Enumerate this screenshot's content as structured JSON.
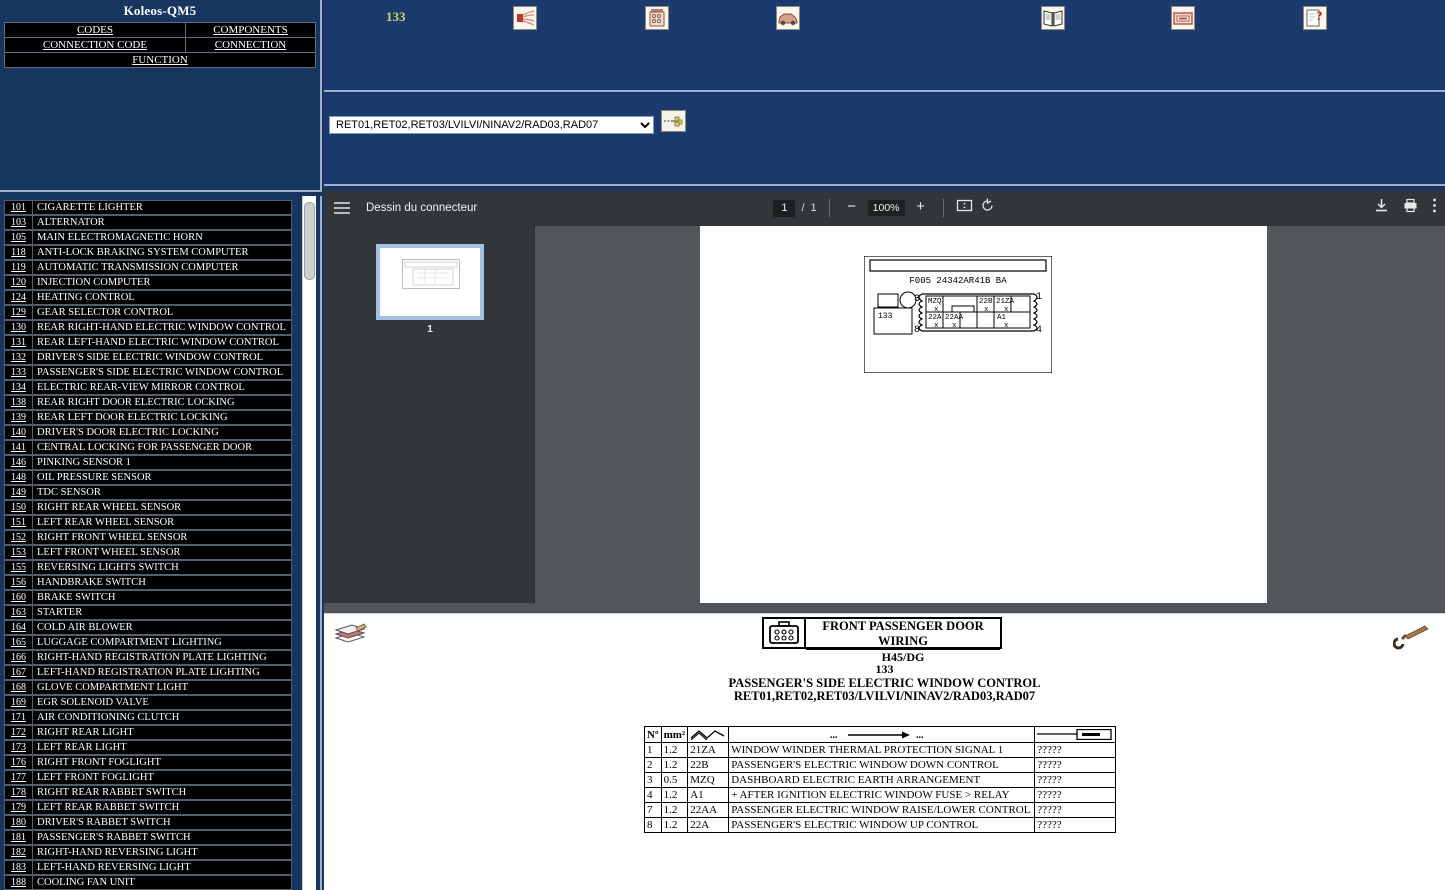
{
  "nav": {
    "title": "Koleos-QM5",
    "rows": [
      [
        {
          "label": "CODES",
          "name": "nav-link-codes"
        },
        {
          "label": "COMPONENTS",
          "name": "nav-link-components"
        }
      ],
      [
        {
          "label": "CONNECTION CODE",
          "name": "nav-link-connection-code"
        },
        {
          "label": "CONNECTION",
          "name": "nav-link-connection"
        }
      ]
    ],
    "function_label": "FUNCTION"
  },
  "banner": {
    "code": "133",
    "icons": [
      {
        "name": "wiring-harness-icon",
        "label": "wiring-harness"
      },
      {
        "name": "connector-list-icon",
        "label": "connector-list"
      },
      {
        "name": "vehicle-icon",
        "label": "vehicle"
      },
      {
        "name": "manual-book-icon",
        "label": "manual-book"
      },
      {
        "name": "fuse-box-icon",
        "label": "fuse-box"
      },
      {
        "name": "help-document-icon",
        "label": "help-document"
      }
    ]
  },
  "selector": {
    "value": "RET01,RET02,RET03/LVILVI/NINAV2/RAD03,RAD07",
    "options": [
      "RET01,RET02,RET03/LVILVI/NINAV2/RAD03,RAD07"
    ],
    "go_button_name": "go-button"
  },
  "pdf": {
    "doc_title": "Dessin du connecteur",
    "page_current": "1",
    "page_sep": "/",
    "page_total": "1",
    "zoom": "100%",
    "minus": "−",
    "plus": "+",
    "thumbnail_label": "1"
  },
  "connector_drawing": {
    "header_ref": "F005  24342AR41B BA",
    "component_code": "133",
    "corner_top_left": "3",
    "corner_top_right": "1",
    "corner_bottom_left": "8",
    "corner_bottom_right": "4",
    "cells_top": [
      "MZQ",
      "22B",
      "21ZA"
    ],
    "cells_bottom": [
      "22A",
      "22AA",
      "A1"
    ]
  },
  "info": {
    "connector_title": "FRONT PASSENGER DOOR WIRING",
    "connector_ref": "H45/DG",
    "component_code": "133",
    "component_name": "PASSENGER'S SIDE ELECTRIC WINDOW CONTROL",
    "variants": "RET01,RET02,RET03/LVILVI/NINAV2/RAD03,RAD07",
    "books_icon_name": "books-icon",
    "wrench_icon_name": "wrench-icon"
  },
  "wire_table": {
    "headers": [
      "Nº",
      "mm²",
      "",
      "",
      ""
    ],
    "rows": [
      {
        "no": "1",
        "mm2": "1.2",
        "code": "21ZA",
        "desc": "WINDOW WINDER THERMAL PROTECTION SIGNAL 1",
        "link": "?????"
      },
      {
        "no": "2",
        "mm2": "1.2",
        "code": "22B",
        "desc": "PASSENGER'S ELECTRIC WINDOW DOWN CONTROL",
        "link": "?????"
      },
      {
        "no": "3",
        "mm2": "0.5",
        "code": "MZQ",
        "desc": "DASHBOARD ELECTRIC EARTH ARRANGEMENT",
        "link": "?????"
      },
      {
        "no": "4",
        "mm2": "1.2",
        "code": "A1",
        "desc": "+ AFTER IGNITION ELECTRIC WINDOW FUSE > RELAY",
        "link": "?????"
      },
      {
        "no": "7",
        "mm2": "1.2",
        "code": "22AA",
        "desc": "PASSENGER ELECTRIC WINDOW RAISE/LOWER CONTROL",
        "link": "?????"
      },
      {
        "no": "8",
        "mm2": "1.2",
        "code": "22A",
        "desc": "PASSENGER'S ELECTRIC WINDOW UP CONTROL",
        "link": "?????"
      }
    ]
  },
  "components_list": [
    {
      "code": "101",
      "label": "CIGARETTE LIGHTER"
    },
    {
      "code": "103",
      "label": "ALTERNATOR"
    },
    {
      "code": "105",
      "label": "MAIN ELECTROMAGNETIC HORN"
    },
    {
      "code": "118",
      "label": "ANTI-LOCK BRAKING SYSTEM COMPUTER"
    },
    {
      "code": "119",
      "label": "AUTOMATIC TRANSMISSION COMPUTER"
    },
    {
      "code": "120",
      "label": "INJECTION COMPUTER"
    },
    {
      "code": "124",
      "label": "HEATING CONTROL"
    },
    {
      "code": "129",
      "label": "GEAR SELECTOR CONTROL"
    },
    {
      "code": "130",
      "label": "REAR RIGHT-HAND ELECTRIC WINDOW CONTROL"
    },
    {
      "code": "131",
      "label": "REAR LEFT-HAND ELECTRIC WINDOW CONTROL"
    },
    {
      "code": "132",
      "label": "DRIVER'S SIDE ELECTRIC WINDOW CONTROL"
    },
    {
      "code": "133",
      "label": "PASSENGER'S SIDE ELECTRIC WINDOW CONTROL"
    },
    {
      "code": "134",
      "label": "ELECTRIC REAR-VIEW MIRROR CONTROL"
    },
    {
      "code": "138",
      "label": "REAR RIGHT DOOR ELECTRIC LOCKING"
    },
    {
      "code": "139",
      "label": "REAR LEFT DOOR ELECTRIC LOCKING"
    },
    {
      "code": "140",
      "label": "DRIVER'S DOOR ELECTRIC LOCKING"
    },
    {
      "code": "141",
      "label": "CENTRAL LOCKING FOR PASSENGER DOOR"
    },
    {
      "code": "146",
      "label": "PINKING SENSOR 1"
    },
    {
      "code": "148",
      "label": "OIL PRESSURE SENSOR"
    },
    {
      "code": "149",
      "label": "TDC SENSOR"
    },
    {
      "code": "150",
      "label": "RIGHT REAR WHEEL SENSOR"
    },
    {
      "code": "151",
      "label": "LEFT REAR WHEEL SENSOR"
    },
    {
      "code": "152",
      "label": "RIGHT FRONT WHEEL SENSOR"
    },
    {
      "code": "153",
      "label": "LEFT FRONT WHEEL SENSOR"
    },
    {
      "code": "155",
      "label": "REVERSING LIGHTS SWITCH"
    },
    {
      "code": "156",
      "label": "HANDBRAKE SWITCH"
    },
    {
      "code": "160",
      "label": "BRAKE SWITCH"
    },
    {
      "code": "163",
      "label": "STARTER"
    },
    {
      "code": "164",
      "label": "COLD AIR BLOWER"
    },
    {
      "code": "165",
      "label": "LUGGAGE COMPARTMENT LIGHTING"
    },
    {
      "code": "166",
      "label": "RIGHT-HAND REGISTRATION PLATE LIGHTING"
    },
    {
      "code": "167",
      "label": "LEFT-HAND REGISTRATION PLATE LIGHTING"
    },
    {
      "code": "168",
      "label": "GLOVE COMPARTMENT LIGHT"
    },
    {
      "code": "169",
      "label": "EGR SOLENOID VALVE"
    },
    {
      "code": "171",
      "label": "AIR CONDITIONING CLUTCH"
    },
    {
      "code": "172",
      "label": "RIGHT REAR LIGHT"
    },
    {
      "code": "173",
      "label": "LEFT REAR LIGHT"
    },
    {
      "code": "176",
      "label": "RIGHT FRONT FOGLIGHT"
    },
    {
      "code": "177",
      "label": "LEFT FRONT FOGLIGHT"
    },
    {
      "code": "178",
      "label": "RIGHT REAR RABBET SWITCH"
    },
    {
      "code": "179",
      "label": "LEFT REAR RABBET SWITCH"
    },
    {
      "code": "180",
      "label": "DRIVER'S RABBET SWITCH"
    },
    {
      "code": "181",
      "label": "PASSENGER'S RABBET SWITCH"
    },
    {
      "code": "182",
      "label": "RIGHT-HAND REVERSING LIGHT"
    },
    {
      "code": "183",
      "label": "LEFT-HAND REVERSING LIGHT"
    },
    {
      "code": "188",
      "label": "COOLING FAN UNIT"
    }
  ],
  "colors": {
    "banner_blue": "#1b3b6f",
    "panel_blue": "#16365f",
    "pdf_chrome": "#323639",
    "pdf_bg": "#525659",
    "accent_yellow": "#c8d86a"
  }
}
